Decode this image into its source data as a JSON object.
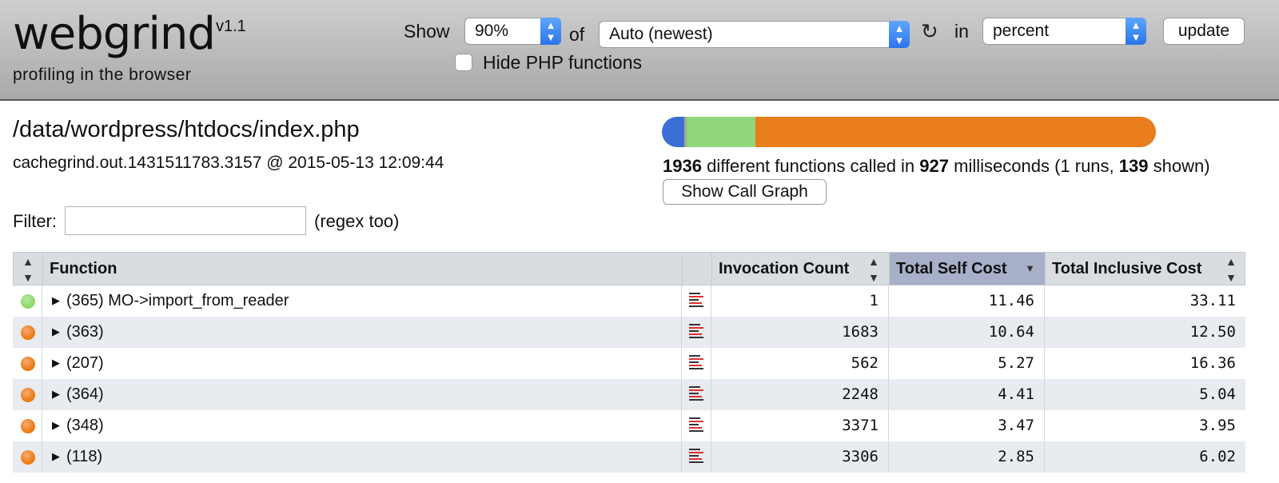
{
  "app": {
    "name": "webgrind",
    "version": "v1.1",
    "tagline": "profiling in the browser"
  },
  "controls": {
    "show_label": "Show",
    "show_value": "90%",
    "of_label": "of",
    "file_value": "Auto (newest)",
    "in_label": "in",
    "unit_value": "percent",
    "update_label": "update",
    "hide_php_label": "Hide PHP functions",
    "hide_php_checked": false
  },
  "info": {
    "file_path": "/data/wordpress/htdocs/index.php",
    "cache_file": "cachegrind.out.1431511783.3157 @ 2015-05-13 12:09:44",
    "cost_breakdown": [
      {
        "name": "blue",
        "color": "#3b6fd6",
        "fraction": 0.045
      },
      {
        "name": "grey",
        "color": "#9ab08c",
        "fraction": 0.005
      },
      {
        "name": "green",
        "color": "#94d67b",
        "fraction": 0.14
      },
      {
        "name": "orange",
        "color": "#ea7d1c",
        "fraction": 0.81
      }
    ],
    "stats": {
      "functions_count": "1936",
      "functions_text": "different functions called in",
      "ms": "927",
      "ms_text": "milliseconds (1 runs,",
      "shown": "139",
      "shown_text": "shown)"
    },
    "call_graph_label": "Show Call Graph",
    "filter_label": "Filter:",
    "filter_value": "",
    "regex_label": "(regex too)"
  },
  "table": {
    "headers": {
      "function": "Function",
      "invocation": "Invocation Count",
      "self_cost": "Total Self Cost",
      "inclusive_cost": "Total Inclusive Cost"
    },
    "rows": [
      {
        "status": "green",
        "status_color": "#8ed86a",
        "function": "(365) MO->import_from_reader",
        "invocation": "1",
        "self_cost": "11.46",
        "inclusive_cost": "33.11"
      },
      {
        "status": "orange",
        "status_color": "#ee7a16",
        "function": "(363)",
        "invocation": "1683",
        "self_cost": "10.64",
        "inclusive_cost": "12.50"
      },
      {
        "status": "orange",
        "status_color": "#ee7a16",
        "function": "(207)",
        "invocation": "562",
        "self_cost": "5.27",
        "inclusive_cost": "16.36"
      },
      {
        "status": "orange",
        "status_color": "#ee7a16",
        "function": "(364)",
        "invocation": "2248",
        "self_cost": "4.41",
        "inclusive_cost": "5.04"
      },
      {
        "status": "orange",
        "status_color": "#ee7a16",
        "function": "(348)",
        "invocation": "3371",
        "self_cost": "3.47",
        "inclusive_cost": "3.95"
      },
      {
        "status": "orange",
        "status_color": "#ee7a16",
        "function": "(118)",
        "invocation": "3306",
        "self_cost": "2.85",
        "inclusive_cost": "6.02"
      }
    ]
  }
}
